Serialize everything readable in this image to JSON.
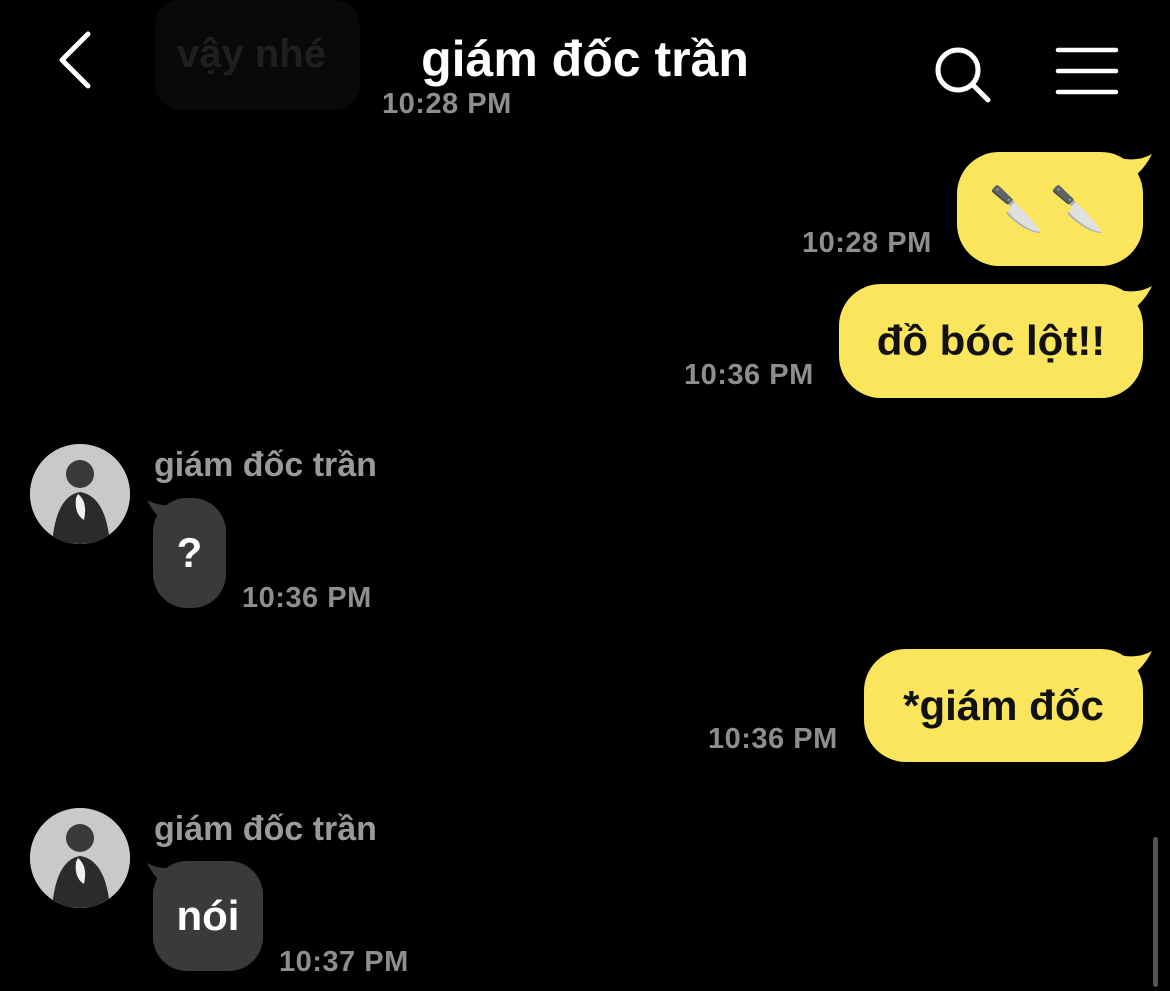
{
  "header": {
    "title": "giám đốc trần",
    "back_icon": "chevron-left-icon",
    "search_icon": "search-icon",
    "menu_icon": "hamburger-menu-icon"
  },
  "previous_message": {
    "text": "vậy nhé",
    "time": "10:28 PM"
  },
  "messages": [
    {
      "direction": "outgoing",
      "text": "🔪🔪",
      "time": "10:28 PM"
    },
    {
      "direction": "outgoing",
      "text": "đồ bóc lột!!",
      "time": "10:36 PM"
    },
    {
      "direction": "incoming",
      "sender": "giám đốc trần",
      "text": "?",
      "time": "10:36 PM"
    },
    {
      "direction": "outgoing",
      "text": "*giám đốc",
      "time": "10:36 PM"
    },
    {
      "direction": "incoming",
      "sender": "giám đốc trần",
      "text": "nói",
      "time": "10:37 PM"
    }
  ],
  "colors": {
    "background": "#000000",
    "outgoing_bubble": "#fae55c",
    "incoming_bubble": "#3a3a3c",
    "timestamp": "#8e8e8e"
  }
}
